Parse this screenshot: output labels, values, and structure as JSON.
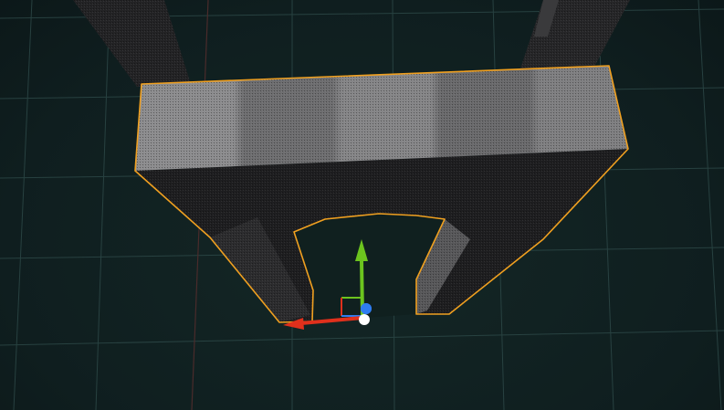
{
  "viewport": {
    "label": "3D viewport",
    "background": "#102021",
    "grid_color": "#2e4a49",
    "axis_line_color": "#4a2b2b"
  },
  "selection": {
    "outline_color": "#f0a020",
    "object": "selected-mesh"
  },
  "gizmo": {
    "mode": "translate",
    "x_axis_color": "#e0301c",
    "y_axis_color": "#6cc41e",
    "z_axis_color": "#2f7cf0",
    "pivot_color": "#ffffff"
  }
}
